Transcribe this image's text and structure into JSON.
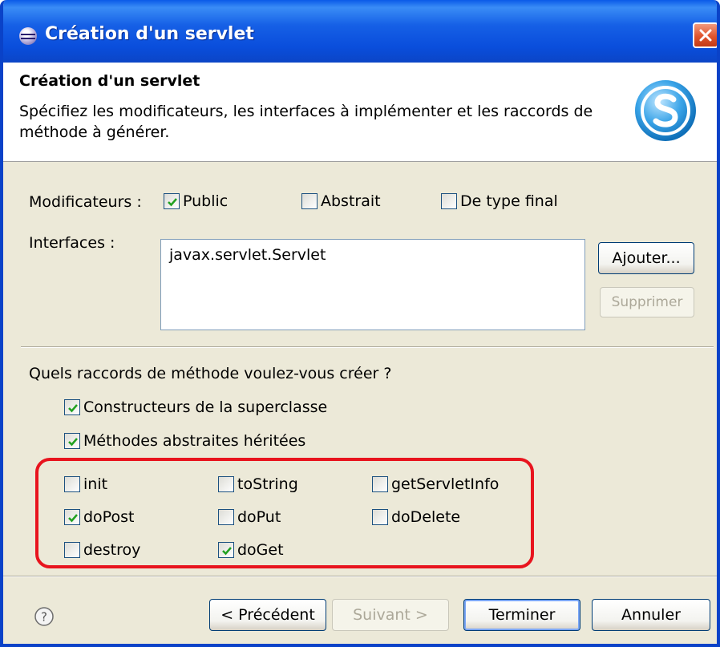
{
  "window": {
    "title": "Création d'un servlet"
  },
  "header": {
    "title": "Création d'un servlet",
    "description": "Spécifiez les modificateurs, les interfaces à implémenter et les raccords de méthode à générer."
  },
  "modifiers": {
    "label": "Modificateurs :",
    "public": {
      "label": "Public",
      "checked": true
    },
    "abstract": {
      "label": "Abstrait",
      "checked": false
    },
    "final": {
      "label": "De type final",
      "checked": false
    }
  },
  "interfaces": {
    "label": "Interfaces :",
    "items": [
      "javax.servlet.Servlet"
    ],
    "add_label": "Ajouter...",
    "remove_label": "Supprimer"
  },
  "stubs": {
    "question": "Quels raccords de méthode voulez-vous créer ?",
    "superclass_constructors": {
      "label": "Constructeurs de la superclasse",
      "checked": true
    },
    "inherited_abstract": {
      "label": "Méthodes abstraites héritées",
      "checked": true
    },
    "methods": [
      {
        "label": "init",
        "checked": false
      },
      {
        "label": "toString",
        "checked": false
      },
      {
        "label": "getServletInfo",
        "checked": false
      },
      {
        "label": "doPost",
        "checked": true
      },
      {
        "label": "doPut",
        "checked": false
      },
      {
        "label": "doDelete",
        "checked": false
      },
      {
        "label": "destroy",
        "checked": false
      },
      {
        "label": "doGet",
        "checked": true
      }
    ]
  },
  "footer": {
    "back_label": "< Précédent",
    "next_label": "Suivant >",
    "finish_label": "Terminer",
    "cancel_label": "Annuler"
  },
  "colors": {
    "titlebar": "#0a4edc",
    "highlight": "#e8141e",
    "checkmark": "#21a121"
  }
}
